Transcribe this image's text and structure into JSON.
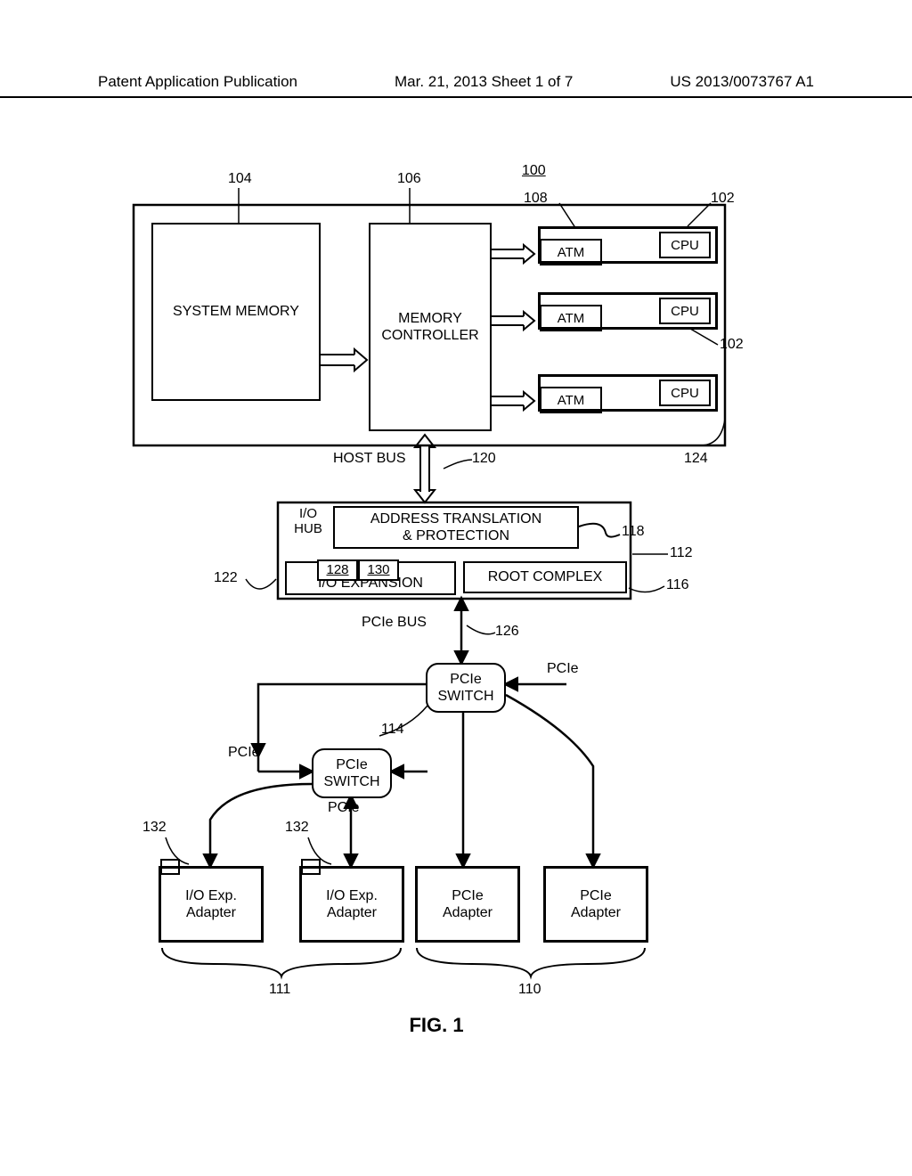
{
  "header": {
    "left": "Patent Application Publication",
    "center": "Mar. 21, 2013  Sheet 1 of 7",
    "right": "US 2013/0073767 A1"
  },
  "refs": {
    "r100": "100",
    "r102a": "102",
    "r102b": "102",
    "r104": "104",
    "r106": "106",
    "r108": "108",
    "r110": "110",
    "r111": "111",
    "r112": "112",
    "r114": "114",
    "r116": "116",
    "r118": "118",
    "r120": "120",
    "r122": "122",
    "r124": "124",
    "r126": "126",
    "r128": "128",
    "r130": "130",
    "r132a": "132",
    "r132b": "132"
  },
  "blocks": {
    "system_memory": "SYSTEM MEMORY",
    "memory_controller": "MEMORY\nCONTROLLER",
    "atm": "ATM",
    "cpu": "CPU",
    "host_bus": "HOST BUS",
    "io_hub": "I/O\nHUB",
    "addr_trans": "ADDRESS TRANSLATION\n& PROTECTION",
    "io_expansion": "I/O EXPANSION",
    "root_complex": "ROOT COMPLEX",
    "pcie_bus": "PCIe BUS",
    "pcie": "PCIe",
    "pcie_switch": "PCIe\nSWITCH",
    "io_exp_adapter": "I/O Exp.\nAdapter",
    "pcie_adapter": "PCIe\nAdapter",
    "fig": "FIG. 1"
  }
}
